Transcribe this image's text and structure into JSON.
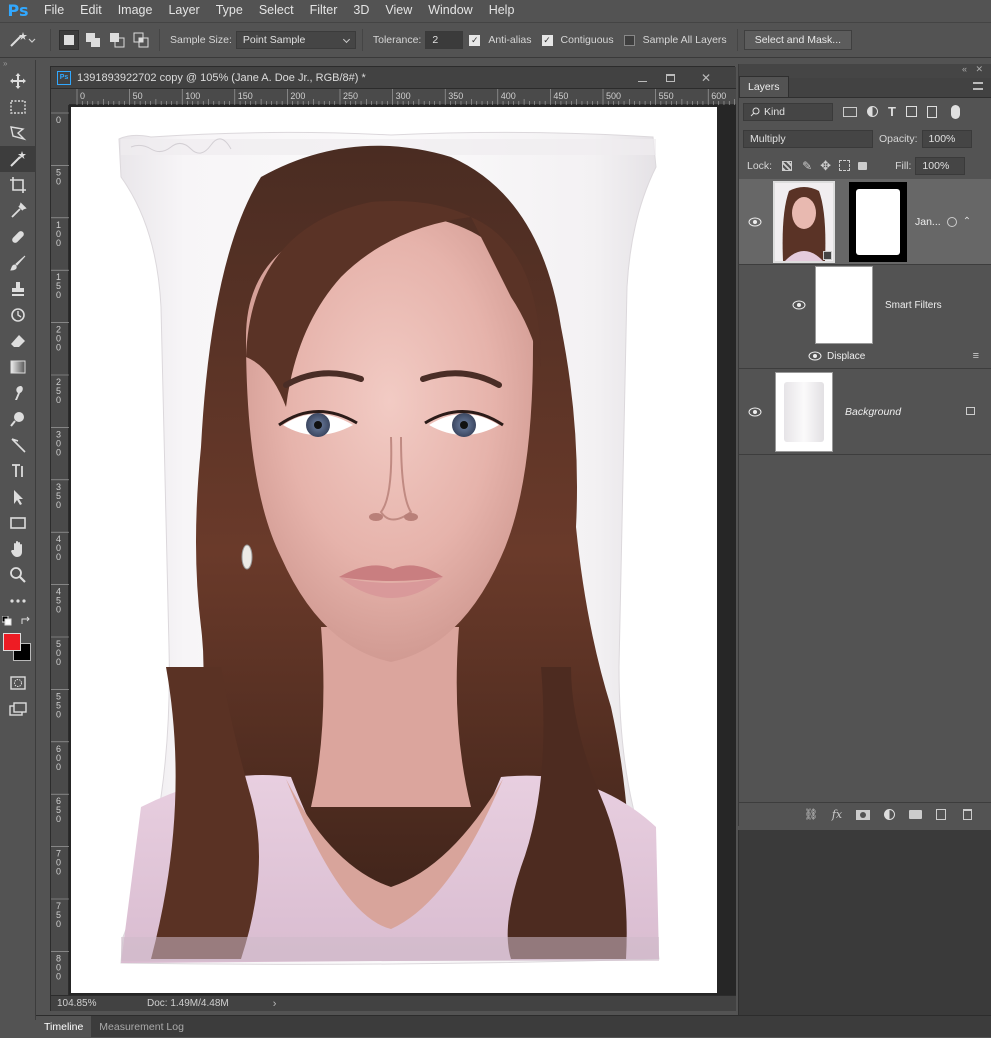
{
  "app": {
    "logo": "Ps"
  },
  "menu": [
    "File",
    "Edit",
    "Image",
    "Layer",
    "Type",
    "Select",
    "Filter",
    "3D",
    "View",
    "Window",
    "Help"
  ],
  "options": {
    "sample_size_label": "Sample Size:",
    "sample_size_value": "Point Sample",
    "tolerance_label": "Tolerance:",
    "tolerance_value": "2",
    "anti_alias": "Anti-alias",
    "contiguous": "Contiguous",
    "sample_all_layers": "Sample All Layers",
    "select_mask_button": "Select and Mask..."
  },
  "document": {
    "title": "1391893922702 copy @ 105% (Jane A. Doe Jr., RGB/8#) *",
    "zoom": "104.85%",
    "doc_size": "Doc: 1.49M/4.48M",
    "ruler_h": [
      "0",
      "50",
      "100",
      "150",
      "200",
      "250",
      "300",
      "350",
      "400",
      "450",
      "500",
      "550",
      "600"
    ],
    "ruler_v": [
      "0",
      "50",
      "100",
      "150",
      "200",
      "250",
      "300",
      "350",
      "400",
      "450",
      "500",
      "550",
      "600",
      "650",
      "700",
      "750",
      "800"
    ]
  },
  "layers_panel": {
    "tab": "Layers",
    "filter_kind": "Kind",
    "blend_mode": "Multiply",
    "opacity_label": "Opacity:",
    "opacity_value": "100%",
    "lock_label": "Lock:",
    "fill_label": "Fill:",
    "fill_value": "100%",
    "layers": [
      {
        "name": "Jan..."
      },
      {
        "name": "Smart Filters"
      },
      {
        "name": "Displace"
      },
      {
        "name": "Background"
      }
    ]
  },
  "bottom_tabs": [
    "Timeline",
    "Measurement Log"
  ],
  "colors": {
    "foreground": "#ee1c24",
    "background": "#000000",
    "accent": "#31a8ff"
  }
}
